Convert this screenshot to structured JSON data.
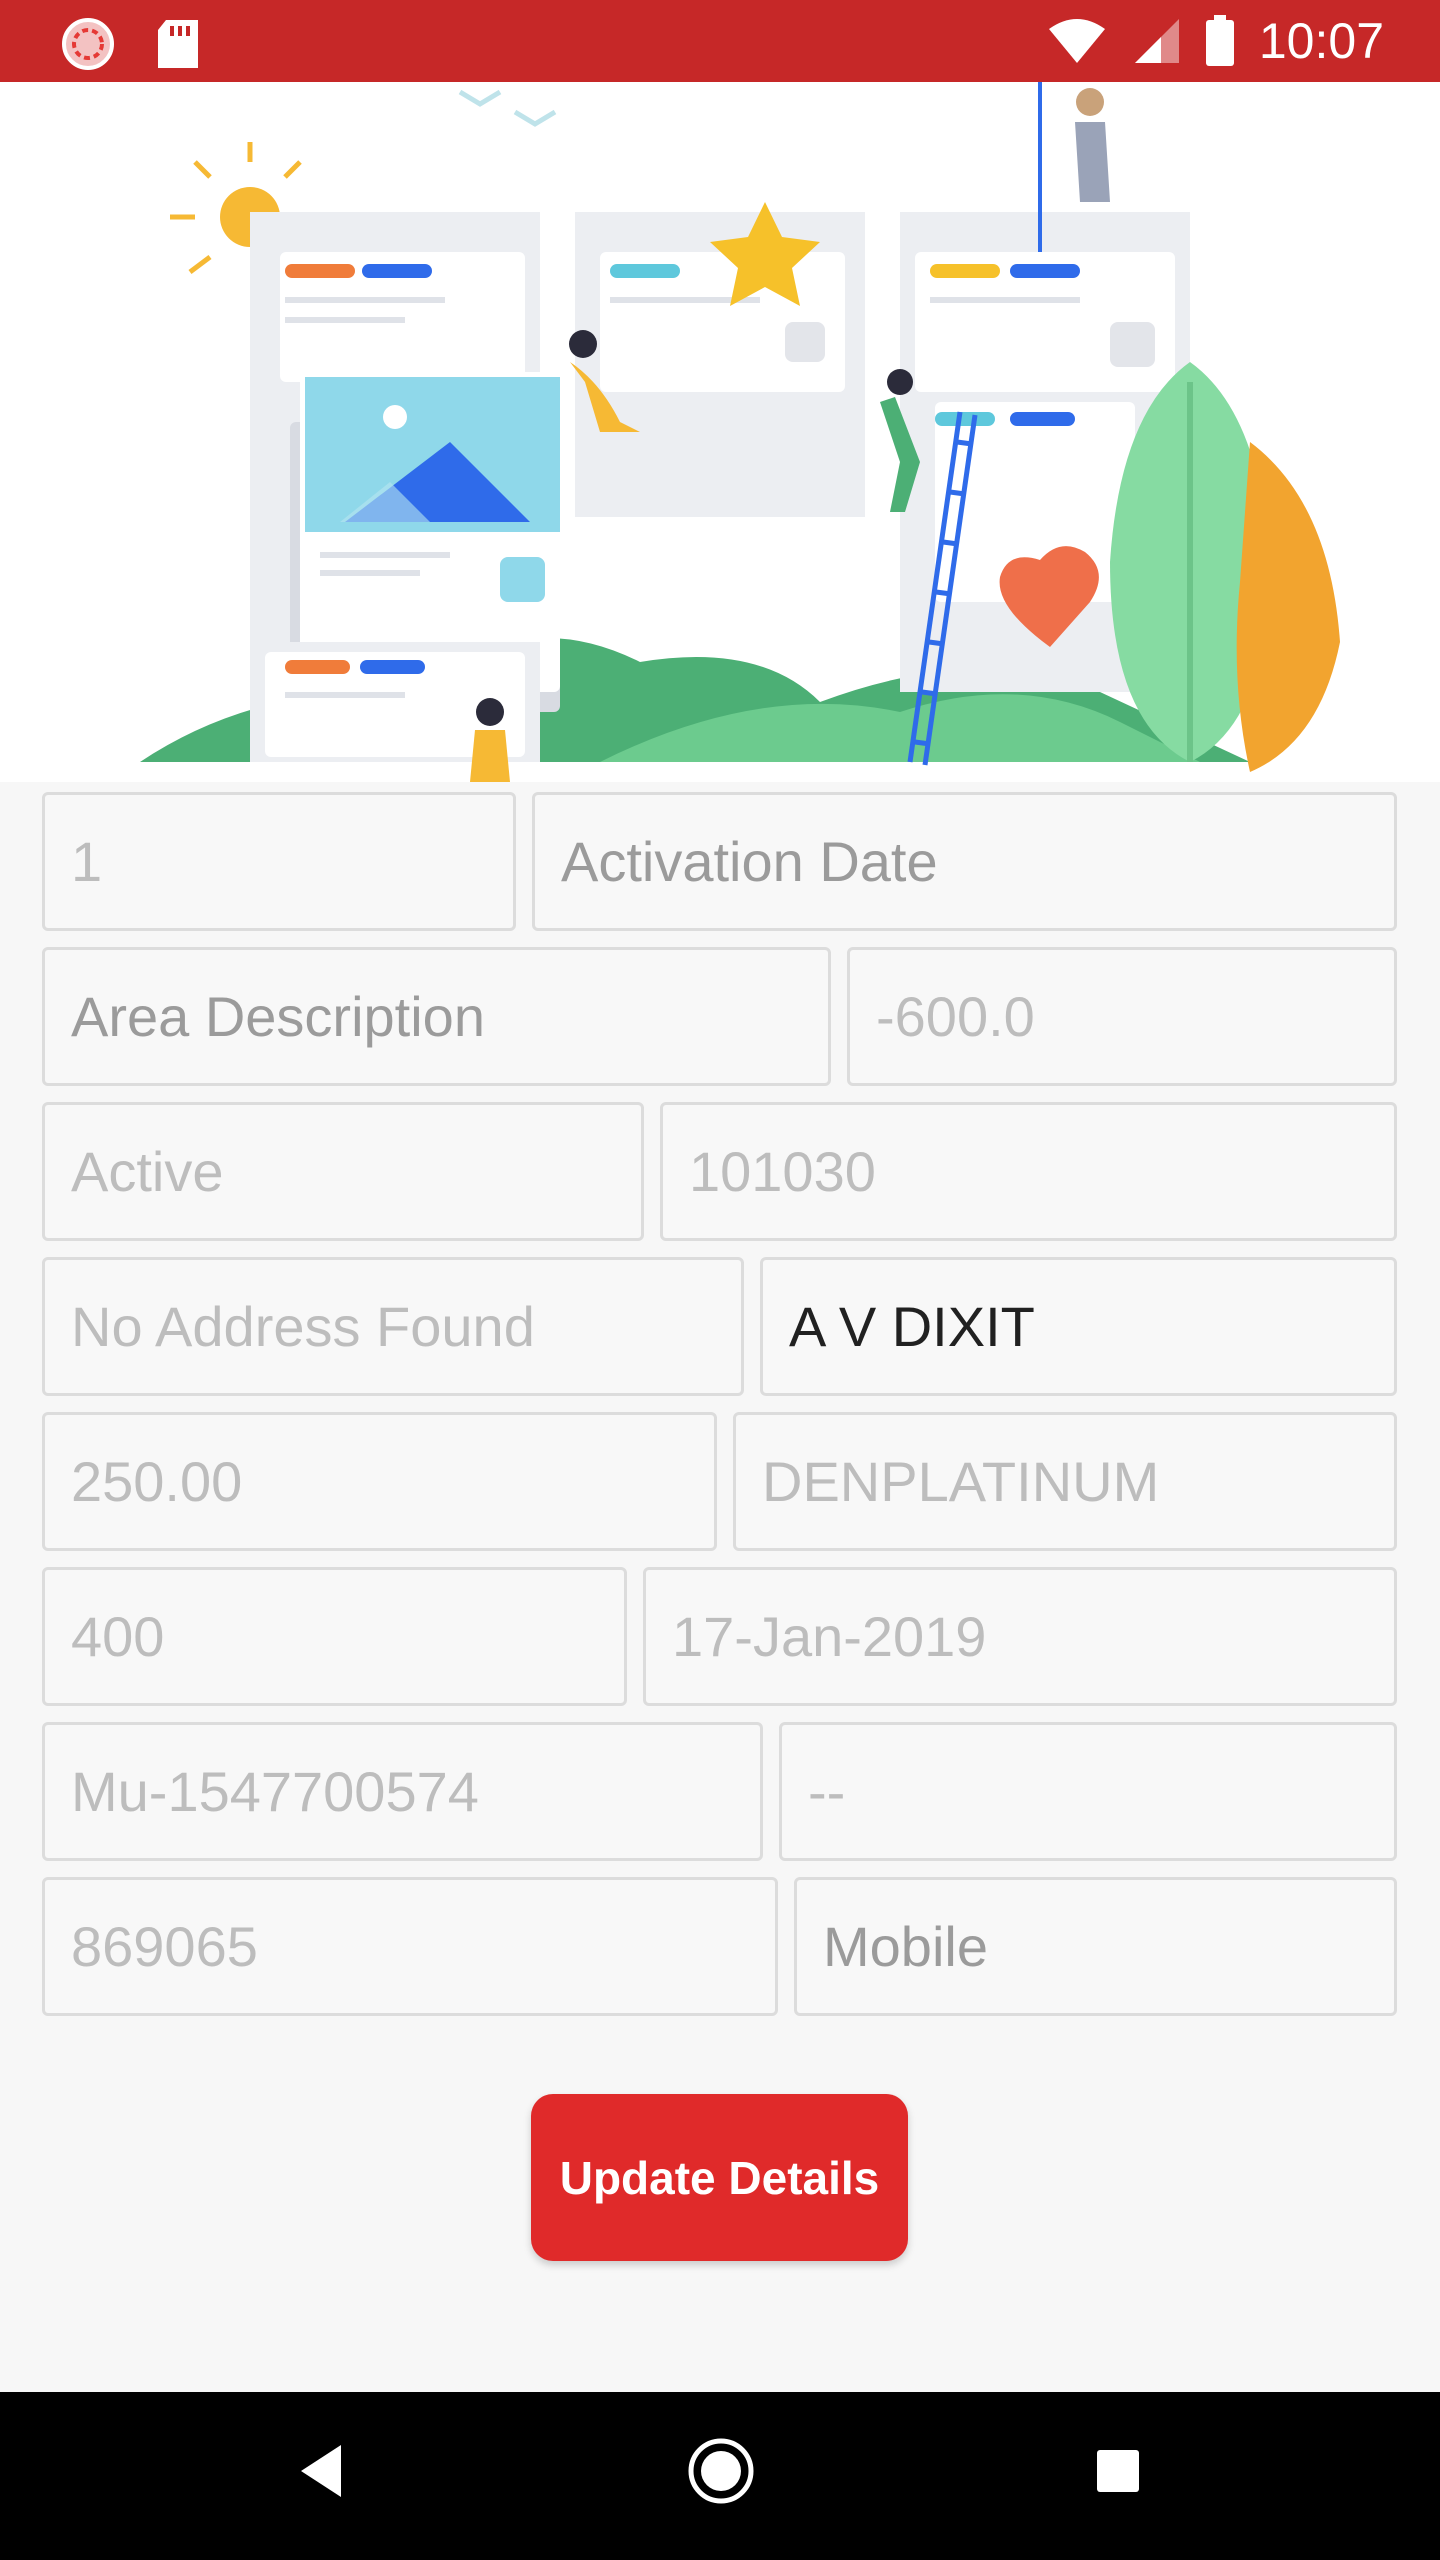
{
  "status_bar": {
    "time": "10:07",
    "color": "#c62828",
    "icons": [
      "sync-icon",
      "sd-card-icon",
      "wifi-icon",
      "signal-icon",
      "battery-icon"
    ]
  },
  "form": {
    "fields": [
      {
        "value": "1",
        "style": "readonly"
      },
      {
        "value": "Activation Date",
        "style": "hint"
      },
      {
        "value": "Area Description",
        "style": "hint"
      },
      {
        "value": "-600.0",
        "style": "readonly"
      },
      {
        "value": "Active",
        "style": "readonly"
      },
      {
        "value": "101030",
        "style": "readonly"
      },
      {
        "value": "No Address Found",
        "style": "readonly"
      },
      {
        "value": "A V DIXIT",
        "style": "value"
      },
      {
        "value": "250.00",
        "style": "readonly"
      },
      {
        "value": "DENPLATINUM",
        "style": "readonly"
      },
      {
        "value": "400",
        "style": "readonly"
      },
      {
        "value": "17-Jan-2019",
        "style": "readonly"
      },
      {
        "value": "Mu-1547700574",
        "style": "readonly"
      },
      {
        "value": "--",
        "style": "readonly"
      },
      {
        "value": "869065",
        "style": "readonly"
      },
      {
        "value": "Mobile",
        "style": "hint"
      }
    ]
  },
  "update_button": {
    "label": "Update Details",
    "color": "#e02a2a"
  },
  "nav_bar": {
    "icons": [
      "back-icon",
      "home-icon",
      "recents-icon"
    ]
  }
}
